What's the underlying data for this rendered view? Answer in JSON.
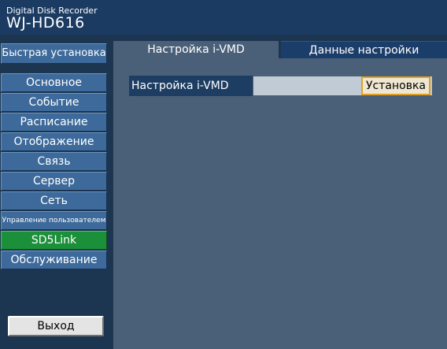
{
  "header": {
    "product": "Digital Disk Recorder",
    "model": "WJ-HD616"
  },
  "sidebar": {
    "quick_setup": "Быстрая установка",
    "items": [
      {
        "label": "Основное"
      },
      {
        "label": "Событие"
      },
      {
        "label": "Расписание"
      },
      {
        "label": "Отображение"
      },
      {
        "label": "Связь"
      },
      {
        "label": "Сервер"
      },
      {
        "label": "Сеть"
      },
      {
        "label": "Управление пользователем"
      },
      {
        "label": "SD5Link"
      },
      {
        "label": "Обслуживание"
      }
    ],
    "active_item": "SD5Link",
    "exit_label": "Выход"
  },
  "main": {
    "tabs": [
      {
        "label": "Настройка i-VMD",
        "selected": true
      },
      {
        "label": "Данные настройки",
        "selected": false
      }
    ],
    "settings": [
      {
        "label": "Настройка i-VMD",
        "button_label": "Установка"
      }
    ]
  },
  "colors": {
    "background": "#1c3550",
    "header": "#1b3b62",
    "sidebar_button": "#3d6a9a",
    "active_button": "#1b8f3a",
    "panel": "#4a6079",
    "focus_border": "#e2a022"
  }
}
